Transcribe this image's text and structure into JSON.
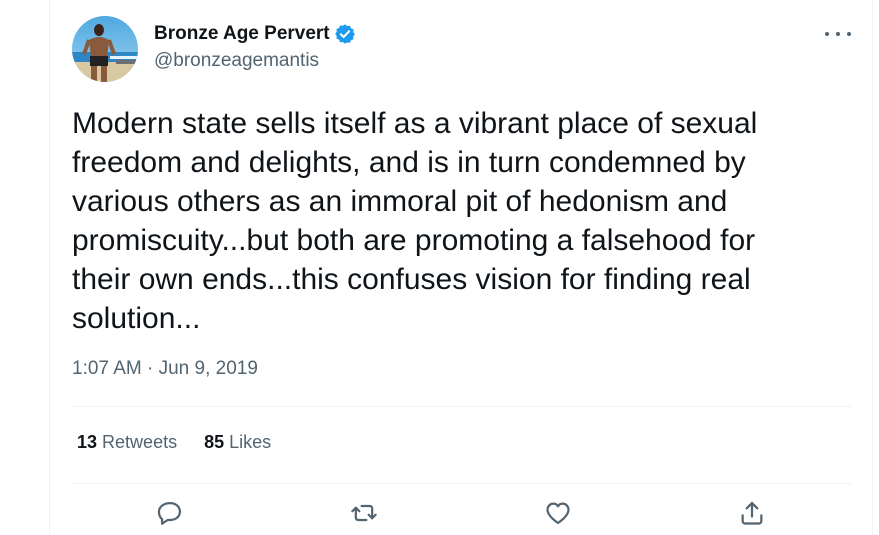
{
  "author": {
    "display_name": "Bronze Age Pervert",
    "handle": "@bronzeagemantis",
    "verified": true,
    "verified_color": "#1d9bf0"
  },
  "tweet": {
    "lines": [
      "Modern state sells itself as a vibrant place of sexual",
      "freedom and delights, and is in turn condemned by",
      "various others as an immoral pit of hedonism and",
      "promiscuity...but both are promoting a falsehood for",
      "their own ends...this confuses vision for finding real",
      "solution..."
    ],
    "timestamp": "1:07 AM · Jun 9, 2019"
  },
  "stats": {
    "retweets_count": "13",
    "retweets_label": "Retweets",
    "likes_count": "85",
    "likes_label": "Likes"
  },
  "actions": [
    "reply-icon",
    "retweet-icon",
    "like-icon",
    "share-icon"
  ],
  "colors": {
    "text_primary": "#0f1419",
    "text_secondary": "#536471",
    "divider": "#eff3f4"
  }
}
